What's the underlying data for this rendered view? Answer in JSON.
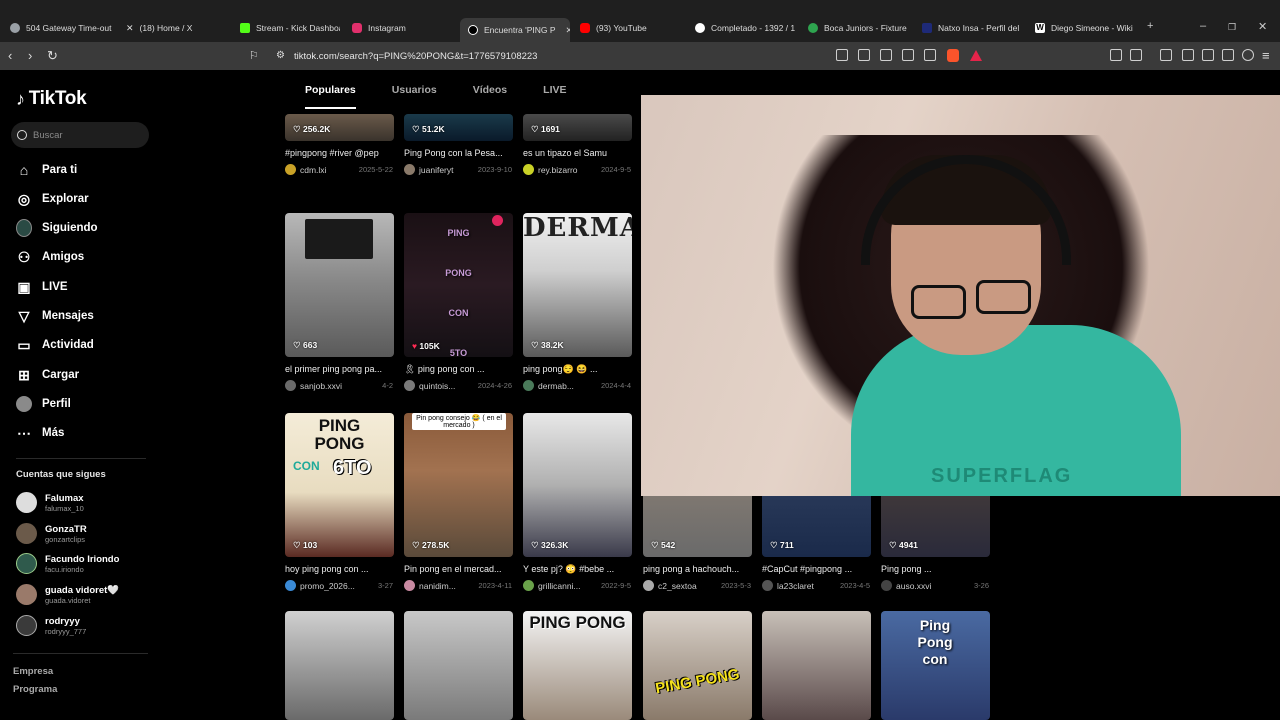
{
  "browser": {
    "tabs": [
      {
        "label": "504 Gateway Time-out",
        "color": "#9aa0a6"
      },
      {
        "label": "(18) Home / X",
        "color": "#ffffff"
      },
      {
        "label": "Stream - Kick Dashboa",
        "color": "#53fc18"
      },
      {
        "label": "Instagram",
        "color": "#e1306c"
      },
      {
        "label": "Encuentra 'PING P",
        "color": "#ffffff"
      },
      {
        "label": "(93) YouTube",
        "color": "#ff0000"
      },
      {
        "label": "Completado - 1392 / 1",
        "color": "#ffffff"
      },
      {
        "label": "Boca Juniors - Fixture",
        "color": "#2ea44f"
      },
      {
        "label": "Natxo Insa - Perfil del",
        "color": "#1e2a78"
      },
      {
        "label": "Diego Simeone - Wiki",
        "color": "#ffffff"
      }
    ],
    "url": "tiktok.com/search?q=PING%20PONG&t=1776579108223"
  },
  "sidebar": {
    "logo": "TikTok",
    "search_placeholder": "Buscar",
    "nav": [
      "Para ti",
      "Explorar",
      "Siguiendo",
      "Amigos",
      "LIVE",
      "Mensajes",
      "Actividad",
      "Cargar",
      "Perfil",
      "Más"
    ],
    "following_title": "Cuentas que sigues",
    "following": [
      {
        "name": "Falumax",
        "user": "falumax_10"
      },
      {
        "name": "GonzaTR",
        "user": "gonzartclips"
      },
      {
        "name": "Facundo Iriondo",
        "user": "facu.iriondo"
      },
      {
        "name": "guada vidoret🤍",
        "user": "guada.vidoret"
      },
      {
        "name": "rodryyy",
        "user": "rodryyy_777"
      }
    ],
    "footer": [
      "Empresa",
      "Programa"
    ]
  },
  "content_tabs": [
    "Populares",
    "Usuarios",
    "Vídeos",
    "LIVE"
  ],
  "row1": [
    {
      "likes": "256.2K",
      "caption": "#pingpong #river @pep",
      "user": "cdm.lxi",
      "date": "2025-5-22"
    },
    {
      "likes": "51.2K",
      "caption": "Ping Pong con la Pesa...",
      "user": "juaniferyt",
      "date": "2023-9-10"
    },
    {
      "likes": "1691",
      "caption": "es un tipazo el Samu",
      "user": "rey.bizarro",
      "date": "2024-9-5"
    }
  ],
  "row2": [
    {
      "likes": "663",
      "caption": "el primer ping pong pa...",
      "user": "sanjob.xxvi",
      "date": "4-2",
      "overlay": ""
    },
    {
      "likes": "105K",
      "caption": "🎗 ping pong con ...",
      "user": "quintois...",
      "date": "2024-4-26",
      "overlay": "PING\nPONG\nCON\n5TO"
    },
    {
      "likes": "38.2K",
      "caption": "ping pong😌 😆 ...",
      "user": "dermab...",
      "date": "2024-4-4",
      "overlay": "DERMA"
    }
  ],
  "row3": [
    {
      "likes": "103",
      "caption": "hoy ping pong con ...",
      "user": "promo_2026...",
      "date": "3-27",
      "overlay": "PING PONG CON 6TO"
    },
    {
      "likes": "278.5K",
      "caption": "Pin pong en el mercad...",
      "user": "nanidim...",
      "date": "2023-4-11",
      "overlay": "Pin pong consejo 😂 ( en el mercado )"
    },
    {
      "likes": "326.3K",
      "caption": "Y este pj? 😳 #bebe ...",
      "user": "grillicanni...",
      "date": "2022-9-5",
      "overlay": ""
    },
    {
      "likes": "542",
      "caption": "ping pong a hachouch...",
      "user": "c2_sextoa",
      "date": "2023-5-3",
      "overlay": ""
    },
    {
      "likes": "711",
      "caption": "#CapCut #pingpong ...",
      "user": "la23claret",
      "date": "2023-4-5",
      "overlay": ""
    },
    {
      "likes": "4941",
      "caption": "Ping pong ...",
      "user": "auso.xxvi",
      "date": "3-26",
      "overlay": ""
    }
  ],
  "row4": [
    {
      "overlay": ""
    },
    {
      "overlay": ""
    },
    {
      "overlay": "PING PONG"
    },
    {
      "overlay": "PING PONG"
    },
    {
      "overlay": ""
    },
    {
      "overlay": "Ping Pong con"
    }
  ],
  "webcam": {
    "shirt_text": "SUPERFLAG"
  }
}
